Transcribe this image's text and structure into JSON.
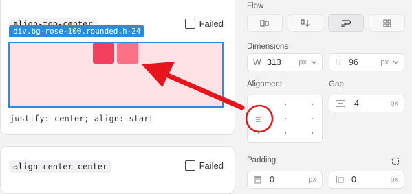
{
  "card1": {
    "tag": "align-top-center",
    "checkbox_label": "Failed",
    "selection_label": "div.bg-rose-100.rounded.h-24",
    "caption": "justify: center; align: start"
  },
  "card2": {
    "tag": "align-center-center",
    "checkbox_label": "Failed"
  },
  "panel": {
    "flow_title": "Flow",
    "flow_options": [
      "flow-row-icon",
      "flow-col-icon",
      "flow-wrap-icon",
      "flow-grid-icon"
    ],
    "flow_selected_index": 2,
    "dimensions_title": "Dimensions",
    "width": {
      "label": "W",
      "value": "313",
      "unit": "px"
    },
    "height": {
      "label": "H",
      "value": "96",
      "unit": "px"
    },
    "alignment_title": "Alignment",
    "gap_title": "Gap",
    "gap": {
      "value": "4",
      "unit": "px"
    },
    "padding_title": "Padding",
    "padding_top": {
      "value": "0",
      "unit": "px"
    },
    "padding_right": {
      "value": "0",
      "unit": "px"
    }
  },
  "colors": {
    "accent_blue": "#2d8bd8",
    "square_dark": "#f43f5e",
    "square_light": "#fb7185",
    "preview_bg": "#ffe2e6",
    "annotation_red": "#e8141c"
  }
}
